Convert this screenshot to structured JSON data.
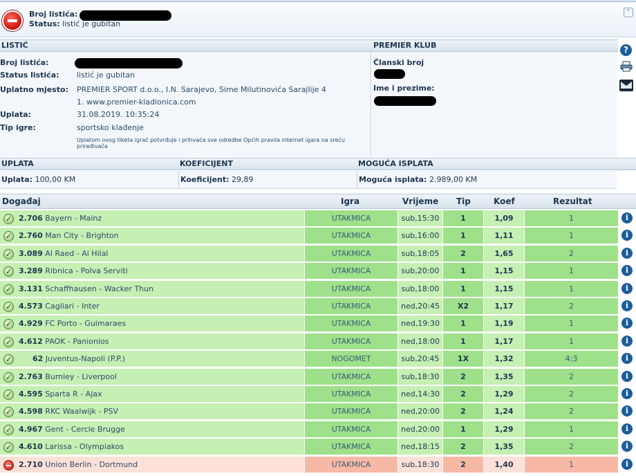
{
  "header": {
    "broj_label": "Broj listića:",
    "status_label": "Status:",
    "status_value": "listić je gubitan"
  },
  "listic": {
    "title": "LISTIĆ",
    "rows": [
      {
        "label": "Broj listića:",
        "value": ""
      },
      {
        "label": "Status listića:",
        "value": "listić je gubitan"
      },
      {
        "label": "Uplatno mjesto:",
        "value": "PREMIER SPORT d.o.o., I.N. Sarajevo, Sime Milutinovića Sarajlije 4"
      },
      {
        "label": "",
        "value": "1. www.premier-kladionica.com"
      },
      {
        "label": "Uplata:",
        "value": "31.08.2019. 10:35:24"
      },
      {
        "label": "Tip igre:",
        "value": "sportsko klađenje"
      }
    ],
    "note": "Uplatom ovog tiketa igrač potvrđuje i prihvaća sve odredbe Općih pravila internet igara na sreću priređivača"
  },
  "club": {
    "title": "PREMIER KLUB",
    "member_label": "Članski broj",
    "name_label": "Ime i prezime:"
  },
  "totals": {
    "uplata_head": "UPLATA",
    "koef_head": "KOEFICIJENT",
    "isplata_head": "MOGUĆA ISPLATA",
    "uplata_label": "Uplata:",
    "uplata_value": "100,00 KM",
    "koef_label": "Koeficijent:",
    "koef_value": "29,89",
    "isplata_label": "Moguća isplata:",
    "isplata_value": "2.989,00 KM"
  },
  "table": {
    "headers": {
      "event": "Događaj",
      "igra": "Igra",
      "time": "Vrijeme",
      "tip": "Tip",
      "koef": "Koef",
      "rez": "Rezultat"
    },
    "rows": [
      {
        "status": "win",
        "code": "2.706",
        "name": "Bayern - Mainz",
        "igra": "UTAKMICA",
        "time": "sub,15:30",
        "tip": "1",
        "koef": "1,09",
        "rez": "1"
      },
      {
        "status": "win",
        "code": "2.760",
        "name": "Man City - Brighton",
        "igra": "UTAKMICA",
        "time": "sub,16:00",
        "tip": "1",
        "koef": "1,11",
        "rez": "1"
      },
      {
        "status": "win",
        "code": "3.089",
        "name": "Al Raed - Al Hilal",
        "igra": "UTAKMICA",
        "time": "sub,18:05",
        "tip": "2",
        "koef": "1,65",
        "rez": "2"
      },
      {
        "status": "win",
        "code": "3.289",
        "name": "Ribnica - Polva Serviti",
        "igra": "UTAKMICA",
        "time": "sub,20:00",
        "tip": "1",
        "koef": "1,15",
        "rez": "1"
      },
      {
        "status": "win",
        "code": "3.131",
        "name": "Schaffhausen - Wacker Thun",
        "igra": "UTAKMICA",
        "time": "sub,18:00",
        "tip": "1",
        "koef": "1,15",
        "rez": "1"
      },
      {
        "status": "win",
        "code": "4.573",
        "name": "Cagliari - Inter",
        "igra": "UTAKMICA",
        "time": "ned,20:45",
        "tip": "X2",
        "koef": "1,17",
        "rez": "2"
      },
      {
        "status": "win",
        "code": "4.929",
        "name": "FC Porto - Guimaraes",
        "igra": "UTAKMICA",
        "time": "ned,19:30",
        "tip": "1",
        "koef": "1,19",
        "rez": "1"
      },
      {
        "status": "win",
        "code": "4.612",
        "name": "PAOK - Panionios",
        "igra": "UTAKMICA",
        "time": "ned,18:00",
        "tip": "1",
        "koef": "1,17",
        "rez": "1"
      },
      {
        "status": "win",
        "code": "62",
        "name": "Juventus-Napoli (P.P.)",
        "igra": "NOGOMET",
        "time": "sub,20:45",
        "tip": "1X",
        "koef": "1,32",
        "rez": "4:3"
      },
      {
        "status": "win",
        "code": "2.763",
        "name": "Burnley - Liverpool",
        "igra": "UTAKMICA",
        "time": "sub,18:30",
        "tip": "2",
        "koef": "1,35",
        "rez": "2"
      },
      {
        "status": "win",
        "code": "4.595",
        "name": "Sparta R - Ajax",
        "igra": "UTAKMICA",
        "time": "ned,14:30",
        "tip": "2",
        "koef": "1,29",
        "rez": "2"
      },
      {
        "status": "win",
        "code": "4.598",
        "name": "RKC Waalwijk - PSV",
        "igra": "UTAKMICA",
        "time": "ned,20:00",
        "tip": "2",
        "koef": "1,24",
        "rez": "2"
      },
      {
        "status": "win",
        "code": "4.967",
        "name": "Gent - Cercle Brugge",
        "igra": "UTAKMICA",
        "time": "ned,20:00",
        "tip": "1",
        "koef": "1,29",
        "rez": "1"
      },
      {
        "status": "win",
        "code": "4.610",
        "name": "Larissa - Olympiakos",
        "igra": "UTAKMICA",
        "time": "ned,18:15",
        "tip": "2",
        "koef": "1,35",
        "rez": "2"
      },
      {
        "status": "lose",
        "code": "2.710",
        "name": "Union Berlin - Dortmund",
        "igra": "UTAKMICA",
        "time": "sub,18:30",
        "tip": "2",
        "koef": "1,40",
        "rez": "1"
      }
    ]
  }
}
